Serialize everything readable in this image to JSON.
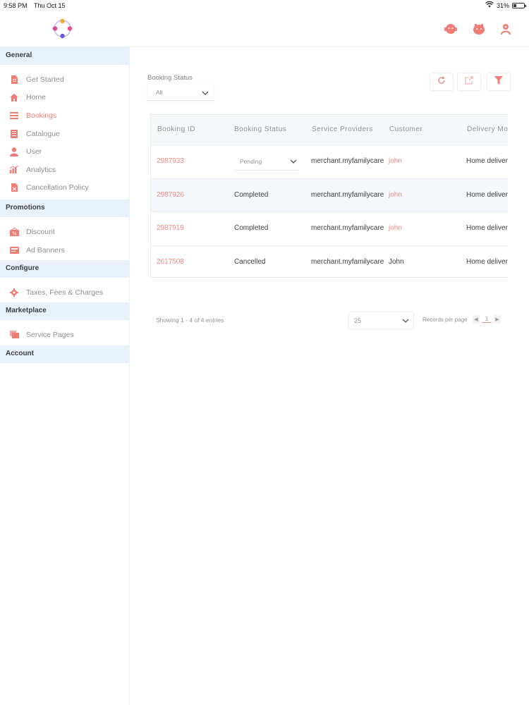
{
  "status_bar": {
    "time": "9:58 PM",
    "date": "Thu Oct 15",
    "battery": "31%",
    "battery_level": 0.31
  },
  "sidebar": {
    "sections": [
      {
        "title": "General",
        "items": [
          {
            "label": "Get Started",
            "icon": "document-icon"
          },
          {
            "label": "Home",
            "icon": "home-icon"
          },
          {
            "label": "Bookings",
            "icon": "list-icon",
            "active": true
          },
          {
            "label": "Catalogue",
            "icon": "book-icon"
          },
          {
            "label": "User",
            "icon": "user-icon"
          },
          {
            "label": "Analytics",
            "icon": "chart-icon"
          },
          {
            "label": "Cancellation Policy",
            "icon": "cancel-doc-icon"
          }
        ]
      },
      {
        "title": "Promotions",
        "items": [
          {
            "label": "Discount",
            "icon": "discount-icon"
          },
          {
            "label": "Ad Banners",
            "icon": "banner-icon"
          }
        ]
      },
      {
        "title": "Configure",
        "items": [
          {
            "label": "Taxes, Fees & Charges",
            "icon": "gear-icon"
          }
        ]
      },
      {
        "title": "Marketplace",
        "items": [
          {
            "label": "Service Pages",
            "icon": "pages-icon"
          }
        ]
      },
      {
        "title": "Account",
        "items": []
      }
    ]
  },
  "filter": {
    "label": "Booking Status",
    "value": "All"
  },
  "table": {
    "headers": [
      "Booking ID",
      "Booking Status",
      "Service Providers",
      "Customer",
      "Delivery Mo"
    ],
    "rows": [
      {
        "id": "2987933",
        "status": "Pending",
        "status_editable": true,
        "provider": "merchant.myfamilycare",
        "customer": "john",
        "customer_link": true,
        "delivery": "Home deliver"
      },
      {
        "id": "2987926",
        "status": "Completed",
        "provider": "merchant.myfamilycare",
        "customer": "john",
        "customer_link": true,
        "delivery": "Home deliver"
      },
      {
        "id": "2987919",
        "status": "Completed",
        "provider": "merchant.myfamilycare",
        "customer": "john",
        "customer_link": true,
        "delivery": "Home deliver"
      },
      {
        "id": "2617508",
        "status": "Cancelled",
        "provider": "merchant.myfamilycare",
        "customer": "John",
        "customer_link": false,
        "delivery": "Home deliver"
      }
    ]
  },
  "pagination": {
    "showing": "Showing 1 - 4 of 4 entries",
    "page_size": "25",
    "per_page_label": "Records per page",
    "current_page": "1"
  },
  "colors": {
    "accent": "#ee7d74",
    "section_bg": "#e6f1fb"
  }
}
